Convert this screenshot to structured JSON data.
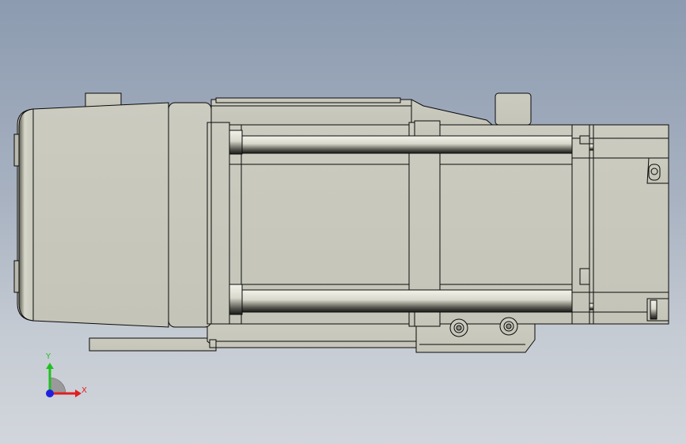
{
  "view": {
    "background_top": "#8c9bb0",
    "background_bottom": "#d2d6dc",
    "part_fill": "#c8c8bc",
    "part_edge": "#0a0a0a"
  },
  "triad": {
    "x_label": "X",
    "y_label": "Y",
    "x_color": "#e02020",
    "y_color": "#20c020",
    "z_color": "#2020e0"
  }
}
